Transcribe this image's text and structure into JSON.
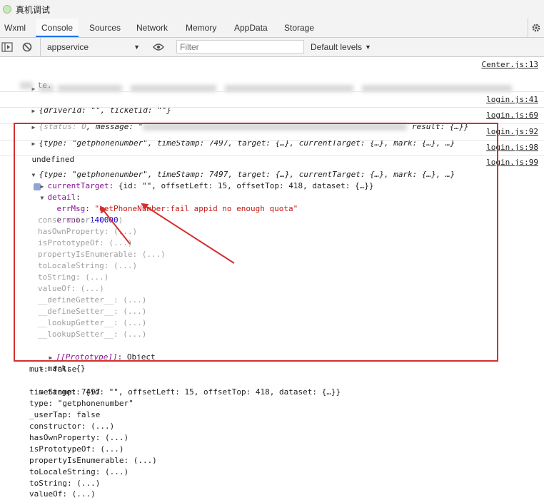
{
  "window": {
    "title": "真机调试"
  },
  "tabs": [
    "Wxml",
    "Console",
    "Sources",
    "Network",
    "Memory",
    "AppData",
    "Storage"
  ],
  "toolbar": {
    "context": "appservice",
    "filter_placeholder": "Filter",
    "levels": "Default levels"
  },
  "console": {
    "src0": "Center.js:13",
    "l1_text": "te.",
    "l2_text": "{driverId: \"\", ticketId: \"\"}",
    "l2_src": "login.js:41",
    "l3_a": "status: 0",
    "l3_b": ", message: \"",
    "l3_c": "result: {…}}",
    "l3_src": "login.js:69",
    "l4_text": "{type: \"getphonenumber\", timeStamp: 7497, target: {…}, currentTarget: {…}, mark: {…}, …}",
    "l4_src": "login.js:92",
    "l5_text": "undefined",
    "l5_src": "login.js:98",
    "l6_text": "{type: \"getphonenumber\", timeStamp: 7497, target: {…}, currentTarget: {…}, mark: {…}, …}",
    "l6_src": "login.js:99",
    "currentTarget_key": "currentTarget",
    "currentTarget_val": ": {id: \"\", offsetLeft: 15, offsetTop: 418, dataset: {…}}",
    "detail_key": "detail",
    "errMsg_key": "errMsg",
    "errMsg_val": "\"getPhoneNumber:fail appid no enough quota\"",
    "errno_key": "errno",
    "errno_val": "140000",
    "constructor": "constructor: (...)",
    "hasOwnProperty": "hasOwnProperty: (...)",
    "isPrototypeOf": "isPrototypeOf: (...)",
    "propertyIsEnumerable": "propertyIsEnumerable: (...)",
    "toLocaleString": "toLocaleString: (...)",
    "toString": "toString: (...)",
    "valueOf": "valueOf: (...)",
    "defineGetter": "__defineGetter__: (...)",
    "defineSetter": "__defineSetter__: (...)",
    "lookupGetter": "__lookupGetter__: (...)",
    "lookupSetter": "__lookupSetter__: (...)",
    "proto_key": "[[Prototype]]",
    "proto_val": ": Object",
    "mark": "mark: {}",
    "mut": "mut: false",
    "target": "target: {id: \"\", offsetLeft: 15, offsetTop: 418, dataset: {…}}",
    "timeStamp": "timeStamp: 7497",
    "type": "type: \"getphonenumber\"",
    "userTap": "_userTap: false",
    "constructor2": "constructor: (...)",
    "hasOwnProperty2": "hasOwnProperty: (...)",
    "isPrototypeOf2": "isPrototypeOf: (...)",
    "propertyIsEnumerable2": "propertyIsEnumerable: (...)",
    "toLocaleString2": "toLocaleString: (...)",
    "toString2": "toString: (...)",
    "valueOf2": "valueOf: (...)"
  }
}
